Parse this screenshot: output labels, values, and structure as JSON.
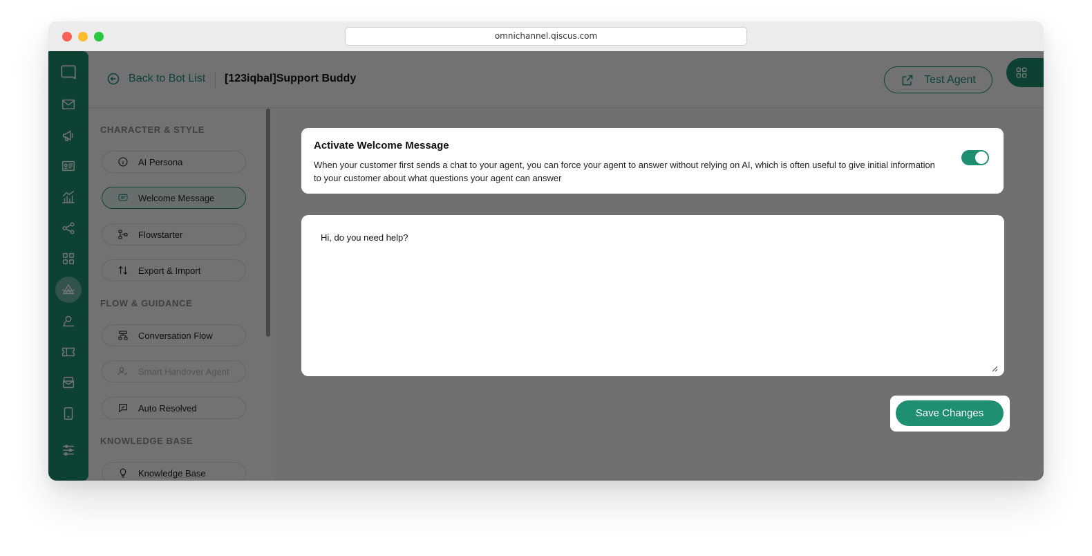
{
  "browser": {
    "url": "omnichannel.qiscus.com"
  },
  "header": {
    "back_label": "Back to Bot List",
    "bot_name": "[123iqbal]Support Buddy",
    "test_agent_label": "Test Agent"
  },
  "rail": {
    "icons": [
      "chat-icon",
      "mail-icon",
      "megaphone-icon",
      "contact-card-icon",
      "analytics-icon",
      "share-icon",
      "apps-grid-icon",
      "ai-agent-icon",
      "user-icon",
      "ticket-icon",
      "inbox-icon",
      "mobile-icon",
      "settings-sliders-icon"
    ],
    "active": "ai-agent-icon"
  },
  "nav": {
    "sections": [
      {
        "title": "CHARACTER & STYLE",
        "items": [
          {
            "label": "AI Persona",
            "icon": "info-icon",
            "state": "normal"
          },
          {
            "label": "Welcome Message",
            "icon": "message-icon",
            "state": "active"
          },
          {
            "label": "Flowstarter",
            "icon": "flow-icon",
            "state": "normal"
          },
          {
            "label": "Export & Import",
            "icon": "arrows-updown-icon",
            "state": "normal"
          }
        ]
      },
      {
        "title": "FLOW & GUIDANCE",
        "items": [
          {
            "label": "Conversation Flow",
            "icon": "hierarchy-icon",
            "state": "normal"
          },
          {
            "label": "Smart Handover Agent",
            "icon": "user-check-icon",
            "state": "disabled"
          },
          {
            "label": "Auto Resolved",
            "icon": "chat-check-icon",
            "state": "normal"
          }
        ]
      },
      {
        "title": "KNOWLEDGE BASE",
        "items": [
          {
            "label": "Knowledge Base",
            "icon": "bulb-icon",
            "state": "normal"
          }
        ]
      }
    ]
  },
  "welcome": {
    "title": "Activate Welcome Message",
    "description": "When your customer first sends a chat to your agent, you can force your agent to answer without relying on AI, which is often useful to give initial information to your customer about what questions your agent can answer",
    "enabled": true
  },
  "message": {
    "value": "Hi, do you need help?"
  },
  "actions": {
    "save_label": "Save Changes"
  },
  "colors": {
    "brand": "#1e8f71",
    "overlay": "rgba(0,0,0,0.54)"
  }
}
